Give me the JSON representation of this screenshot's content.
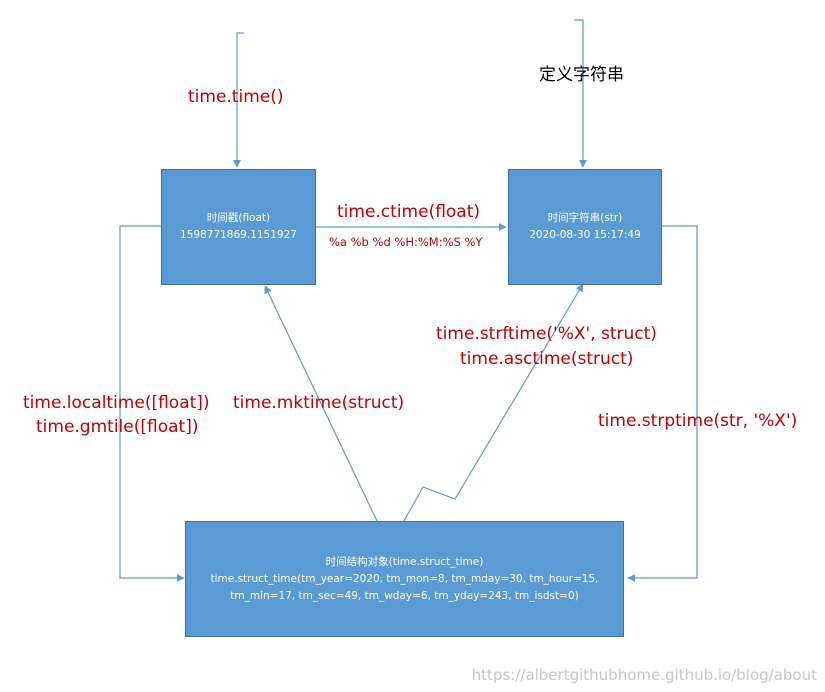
{
  "colors": {
    "box_fill": "#5b9bd5",
    "box_border": "#41719c",
    "arrow": "#5b9bd5",
    "method_text": "#c00000"
  },
  "boxes": {
    "timestamp": {
      "title": "时间戳(float)",
      "value": "1598771869.1151927"
    },
    "time_string": {
      "title": "时间字符串(str)",
      "value": "2020-08-30 15:17:49"
    },
    "struct": {
      "title": "时间结构对象(time.struct_time)",
      "line1": "time.struct_time(tm_year=2020, tm_mon=8, tm_mday=30, tm_hour=15,",
      "line2": "tm_min=17, tm_sec=49, tm_wday=6, tm_yday=243, tm_isdst=0)"
    }
  },
  "labels": {
    "time_time": "time.time()",
    "define_string": "定义字符串",
    "ctime": "time.ctime(float)",
    "ctime_format": "%a %b %d %H:%M:%S %Y",
    "strftime": "time.strftime('%X', struct)",
    "asctime": "time.asctime(struct)",
    "localtime": "time.localtime([float])",
    "gmtile": "time.gmtile([float])",
    "mktime": "time.mktime(struct)",
    "strptime": "time.strptime(str, '%X')"
  },
  "watermark": "https://albertgithubhome.github.io/blog/about"
}
